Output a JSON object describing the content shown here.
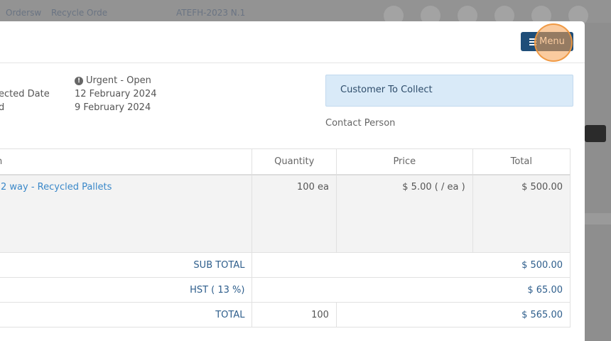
{
  "background": {
    "crumbs": [
      "Ordersw",
      "Recycle Orde",
      "ATEFH-2023 N.1"
    ]
  },
  "header": {
    "menu_label": "Menu"
  },
  "info": {
    "status": "Urgent - Open",
    "expected_label": "ected Date",
    "expected_value": "12 February 2024",
    "ordered_label": "d",
    "ordered_value": "9 February 2024"
  },
  "delivery": {
    "method": "Customer To Collect",
    "contact_label": "Contact Person"
  },
  "table": {
    "headers": {
      "item": "n",
      "quantity": "Quantity",
      "price": "Price",
      "total": "Total"
    },
    "rows": [
      {
        "item": "2 way - Recycled Pallets",
        "quantity": "100 ea",
        "price": "$ 5.00 ( / ea )",
        "total": "$ 500.00"
      }
    ],
    "sub_total_label": "SUB TOTAL",
    "sub_total_value": "$ 500.00",
    "tax_label": "HST ( 13 %)",
    "tax_value": "$ 65.00",
    "total_label": "TOTAL",
    "total_qty": "100",
    "total_value": "$ 565.00"
  },
  "colors": {
    "menu_button": "#1f4e79",
    "link": "#3a88c9",
    "collect_box": "#d9eaf8"
  }
}
